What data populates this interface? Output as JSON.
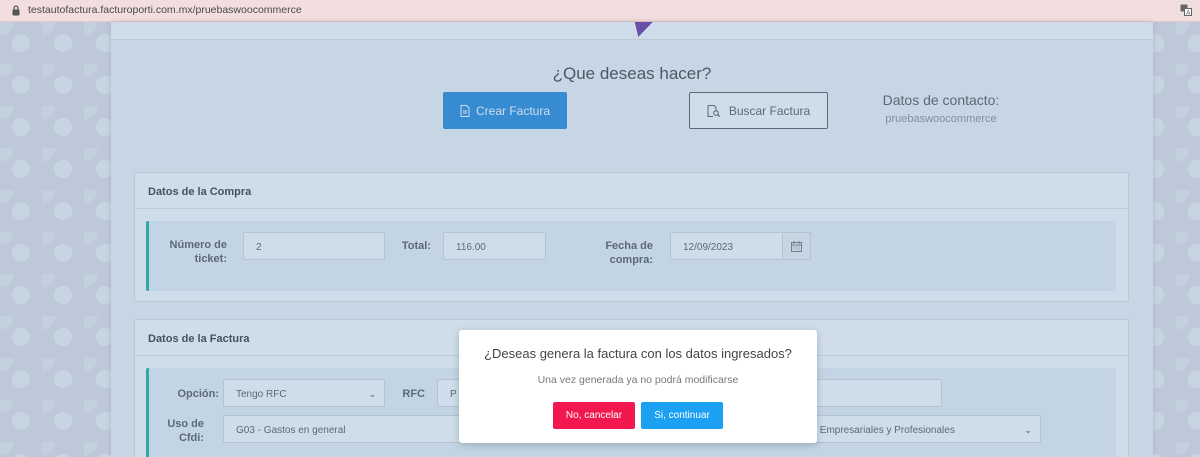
{
  "browser": {
    "url": "testautofactura.facturoporti.com.mx/pruebaswoocommerce"
  },
  "header": {
    "question": "¿Que deseas hacer?",
    "crear_label": "Crear Factura",
    "buscar_label": "Buscar Factura",
    "contact_title": "Datos de contacto:",
    "contact_name": "pruebaswoocommerce"
  },
  "compra": {
    "title": "Datos de la Compra",
    "ticket_label": "Número de ticket:",
    "ticket_value": "2",
    "total_label": "Total:",
    "total_value": "116.00",
    "fecha_label": "Fecha de compra:",
    "fecha_value": "12/09/2023"
  },
  "factura": {
    "title": "Datos de la Factura",
    "opcion_label": "Opción:",
    "opcion_value": "Tengo RFC",
    "rfc_label": "RFC",
    "rfc_value": "P",
    "uso_label": "Uso de Cfdi:",
    "uso_value": "G03 - Gastos en general",
    "regimen_value": "s Empresariales y Profesionales"
  },
  "modal": {
    "title": "¿Deseas genera la factura con los datos ingresados?",
    "subtitle": "Una vez generada ya no podrá modificarse",
    "cancel_label": "No, cancelar",
    "confirm_label": "Si, continuar"
  },
  "colors": {
    "primary": "#1e87db",
    "cancel": "#f2184f",
    "confirm": "#1ba0f2",
    "accent_border": "#1bb09a"
  },
  "icons": {
    "lock": "lock-icon",
    "translate": "translate-icon",
    "crear": "document-icon",
    "buscar": "search-document-icon",
    "calendar": "calendar-icon",
    "select": "chevron-down-icon"
  }
}
